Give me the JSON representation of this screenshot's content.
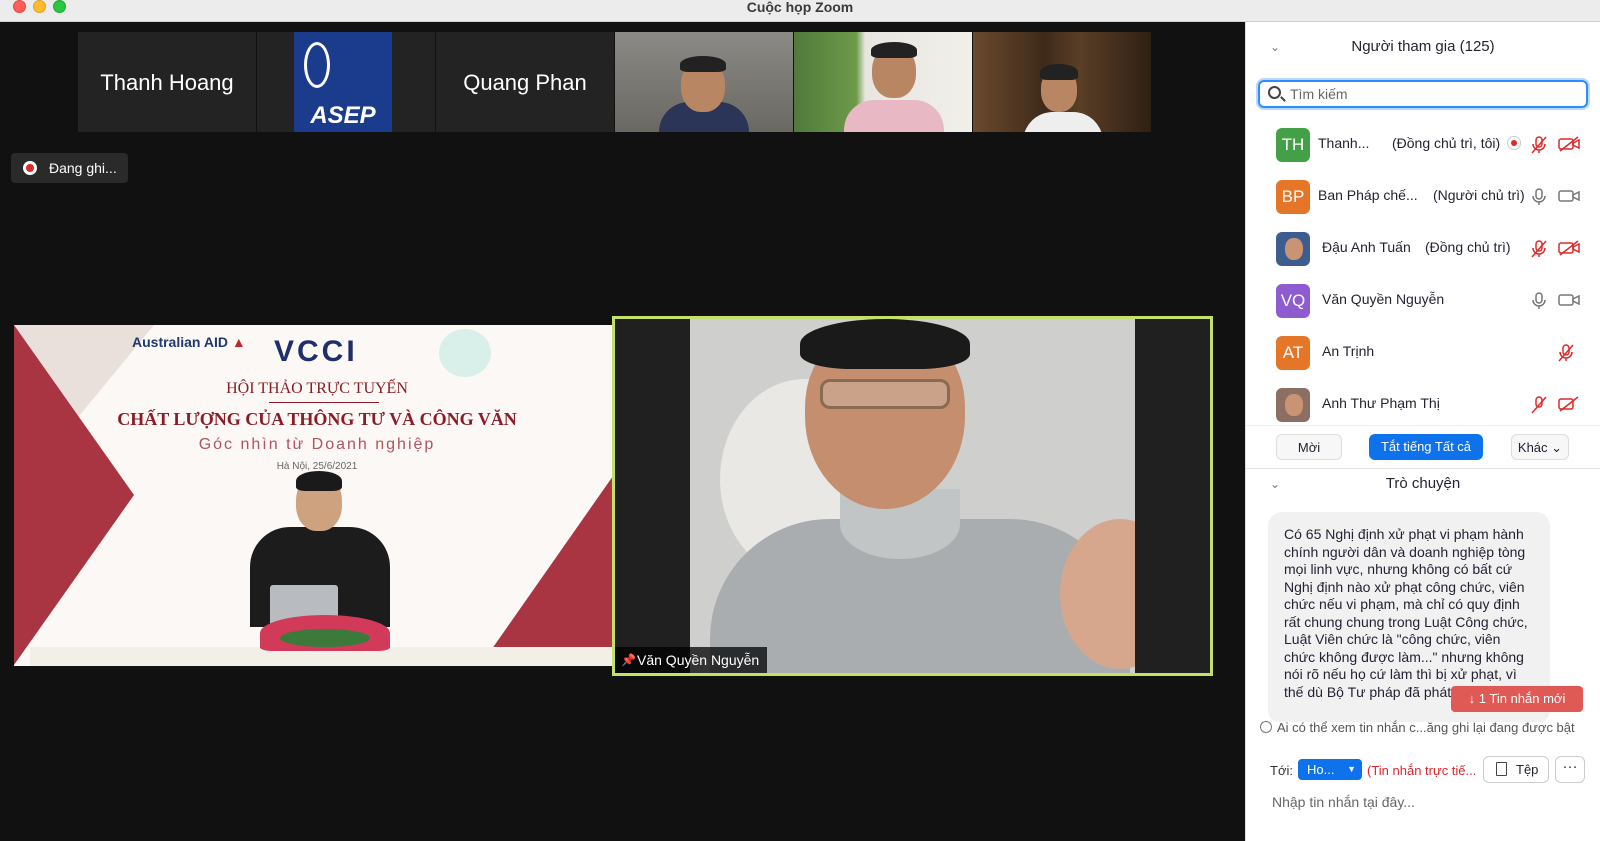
{
  "window": {
    "title": "Cuộc họp Zoom"
  },
  "gallery": {
    "thumbnails": [
      {
        "name": "Thanh Hoang",
        "kind": "name"
      },
      {
        "name": "ASEP",
        "kind": "logo"
      },
      {
        "name": "Quang Phan",
        "kind": "name"
      },
      {
        "name": "",
        "kind": "video"
      },
      {
        "name": "",
        "kind": "video"
      },
      {
        "name": "",
        "kind": "video"
      }
    ],
    "next_icon": "chevron-right-icon"
  },
  "recording": {
    "label": "Đang ghi..."
  },
  "slide": {
    "logo_left": "Australian AID",
    "logo_center": "VCCI",
    "subtitle": "HỘI THẢO TRỰC TUYẾN",
    "title": "CHẤT LƯỢNG CỦA THÔNG TƯ VÀ CÔNG VĂN",
    "tagline": "Góc nhìn từ Doanh nghiệp",
    "date": "Hà Nội, 25/6/2021"
  },
  "speaker": {
    "name": "Văn Quyền Nguyễn"
  },
  "participants": {
    "header": "Người tham gia (125)",
    "search_placeholder": "Tìm kiếm",
    "list": [
      {
        "initials": "TH",
        "color": "#43a047",
        "name": "Thanh...",
        "role": "(Đồng chủ trì, tôi)",
        "mic": "muted",
        "cam": "off",
        "recording": true
      },
      {
        "initials": "BP",
        "color": "#e57628",
        "name": "Ban Pháp chế...",
        "role": "(Người chủ trì)",
        "mic": "on",
        "cam": "on",
        "recording": false
      },
      {
        "initials": "",
        "color": "#3d5d8f",
        "name": "Đậu Anh Tuấn",
        "role": "(Đồng chủ trì)",
        "mic": "muted",
        "cam": "off",
        "recording": false,
        "photo": true
      },
      {
        "initials": "VQ",
        "color": "#8e5bd0",
        "name": "Văn Quyền Nguyễn",
        "role": "",
        "mic": "on",
        "cam": "on",
        "recording": false
      },
      {
        "initials": "AT",
        "color": "#e57628",
        "name": "An Trịnh",
        "role": "",
        "mic": "muted",
        "cam": "none",
        "recording": false
      },
      {
        "initials": "",
        "color": "#8d6e63",
        "name": "Anh Thư Phạm Thị",
        "role": "",
        "mic": "muted",
        "cam": "off",
        "recording": false,
        "photo": true
      }
    ],
    "invite": "Mời",
    "mute_all": "Tắt tiếng Tất cả",
    "more": "Khác"
  },
  "chat": {
    "header": "Trò chuyện",
    "message": "Có 65 Nghị định xử phạt vi phạm hành chính người dân và doanh nghiệp tòng mọi linh vực, nhưng không có bất cứ Nghị định nào xử phạt công chức, viên chức nếu vi phạm, mà chỉ có quy định rất chung chung trong Luật Công chức, Luật Viên chức là \"công chức, viên chức không được làm...\" nhưng không nói rõ nếu họ cứ làm thì bị xử phạt, vì thế dù Bộ Tư pháp đã phát hiện ra",
    "new_message": "↓ 1 Tin nhắn mới",
    "notice": "Ai có thể xem tin nhắn c...ăng ghi lại đang được bật",
    "to_label": "Tới:",
    "to_value": "Ho...",
    "to_note": "(Tin nhắn trực tiế...",
    "file_label": "Tệp",
    "more_label": "···",
    "input_placeholder": "Nhập tin nhắn tại đây..."
  }
}
